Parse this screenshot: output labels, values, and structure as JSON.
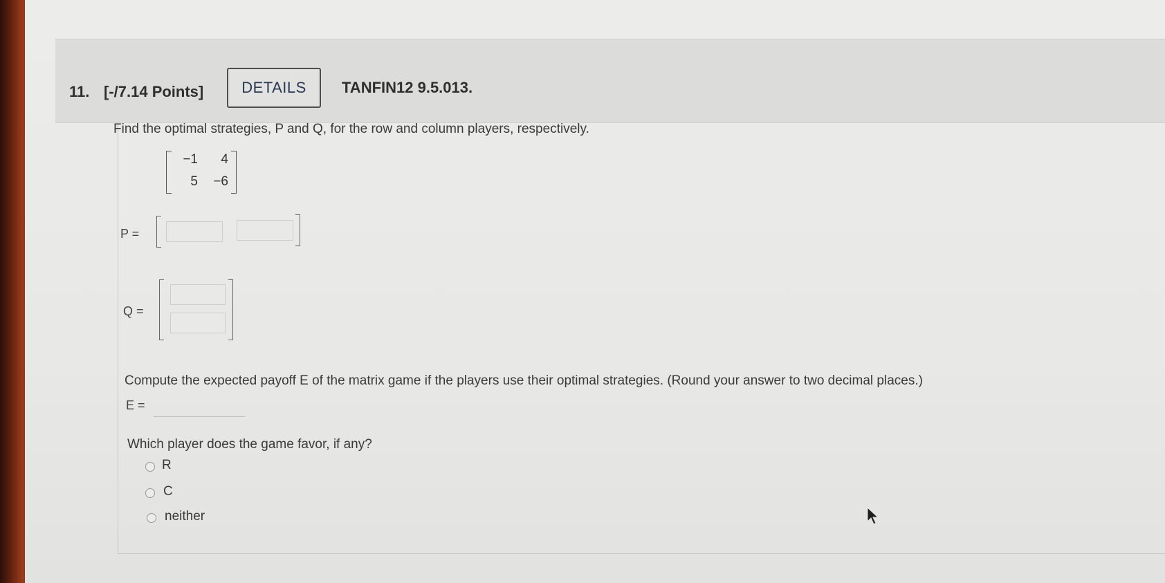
{
  "question": {
    "number": "11.",
    "points": "[-/7.14 Points]",
    "details_label": "DETAILS",
    "code": "TANFIN12 9.5.013."
  },
  "instructions": "Find the optimal strategies, P and Q, for the row and column players, respectively.",
  "matrix": {
    "rows": [
      [
        "−1",
        "4"
      ],
      [
        "5",
        "−6"
      ]
    ]
  },
  "p_label": "P =",
  "q_label": "Q =",
  "compute_text": "Compute the expected payoff E of the matrix game if the players use their optimal strategies. (Round your answer to two decimal places.)",
  "e_label": "E =",
  "favor_question": "Which player does the game favor, if any?",
  "options": [
    "R",
    "C",
    "neither"
  ]
}
